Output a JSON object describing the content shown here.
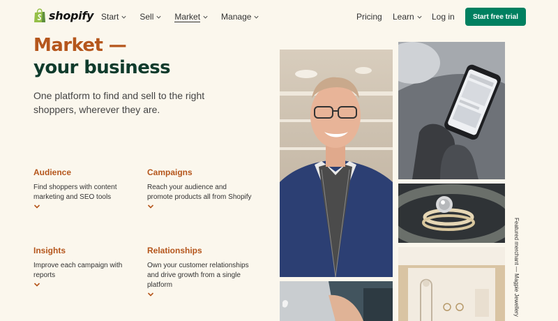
{
  "brand": {
    "name": "shopify",
    "color": "#95bf47"
  },
  "nav": {
    "left": [
      {
        "label": "Start",
        "dropdown": true
      },
      {
        "label": "Sell",
        "dropdown": true
      },
      {
        "label": "Market",
        "dropdown": true,
        "active": true
      },
      {
        "label": "Manage",
        "dropdown": true
      }
    ],
    "pricing": "Pricing",
    "learn": "Learn",
    "login": "Log in",
    "cta": "Start free trial"
  },
  "hero": {
    "title_line1": "Market —",
    "title_line2": "your business",
    "subtitle": "One platform to find and sell to the right shoppers, wherever they are."
  },
  "features": [
    {
      "title": "Audience",
      "text": "Find shoppers with content marketing and SEO tools"
    },
    {
      "title": "Campaigns",
      "text": "Reach your audience and promote products all from Shopify"
    },
    {
      "title": "Insights",
      "text": "Improve each campaign with reports"
    },
    {
      "title": "Relationships",
      "text": "Own your customer relationships and drive growth from a single platform"
    }
  ],
  "caption": "Featured merchant — Magpie Jewellery",
  "colors": {
    "accent": "#b5561c",
    "dark_green": "#0f3b2c",
    "cta": "#008060",
    "background": "#fbf7ed"
  }
}
